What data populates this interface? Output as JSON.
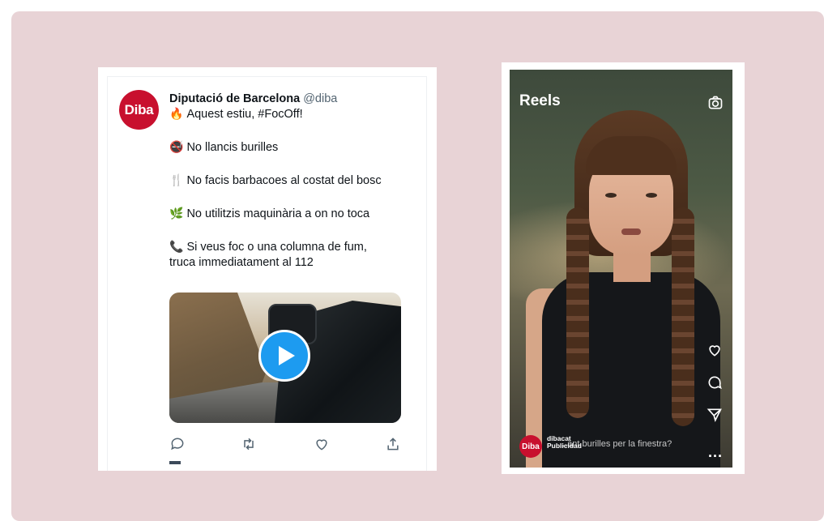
{
  "tweet": {
    "avatar_text": "Diba",
    "author_name": "Diputació de Barcelona",
    "author_handle": "@diba",
    "lines": [
      {
        "emoji": "🔥",
        "text": "Aquest estiu, #FocOff!"
      },
      {
        "emoji": "🚭",
        "text": "No llancis burilles"
      },
      {
        "emoji": "🍴",
        "text": "No facis barbacoes al costat del bosc"
      },
      {
        "emoji": "🌿",
        "text": "No utilitzis maquinària a on no toca"
      },
      {
        "emoji": "📞",
        "text": "Si veus foc o una columna de fum,"
      },
      {
        "emoji": "",
        "text": "truca immediatament al 112"
      }
    ],
    "icons": {
      "reply": "reply-icon",
      "retweet": "retweet-icon",
      "like": "heart-icon",
      "share": "share-icon",
      "play": "play-icon"
    },
    "colors": {
      "play_button": "#1d9bf0",
      "avatar_bg": "#c8102e"
    }
  },
  "reels": {
    "title": "Reels",
    "avatar_text": "Diba",
    "account_name": "dibacat",
    "account_label": "Publicidad",
    "caption": "...ant burilles per la finestra?",
    "more": "...",
    "icons": {
      "camera": "camera-icon",
      "like": "heart-icon",
      "comment": "comment-icon",
      "share": "send-icon"
    }
  }
}
